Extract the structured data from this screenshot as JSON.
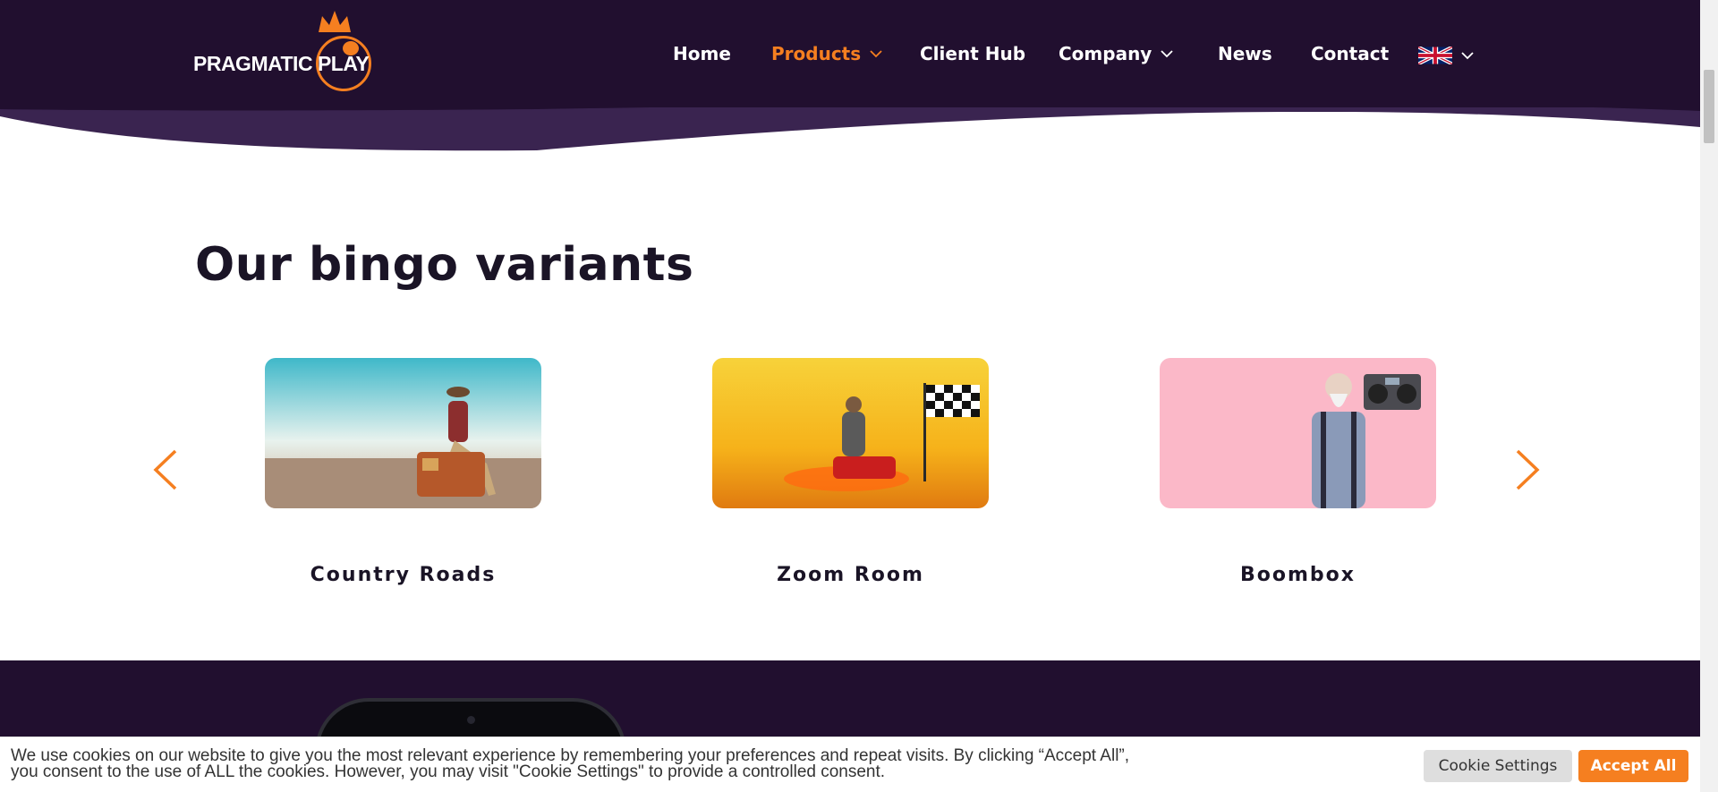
{
  "header": {
    "logo_text_left": "PRAGMATIC",
    "logo_text_right": "PLAY",
    "nav": [
      {
        "label": "Home"
      },
      {
        "label": "Products"
      },
      {
        "label": "Client Hub"
      },
      {
        "label": "Company"
      },
      {
        "label": "News"
      },
      {
        "label": "Contact"
      }
    ],
    "language_icon": "uk-flag-icon",
    "active_nav": "Products",
    "accent_color": "#f57f20",
    "header_color": "#210f2f"
  },
  "section": {
    "title": "Our bingo variants",
    "prev_icon": "chevron-left-icon",
    "next_icon": "chevron-right-icon",
    "cards": [
      {
        "title": "Country Roads"
      },
      {
        "title": "Zoom Room"
      },
      {
        "title": "Boombox"
      }
    ]
  },
  "cookie_bar": {
    "text": "We use cookies on our website to give you the most relevant experience by remembering your preferences and repeat visits. By clicking “Accept All”, you consent to the use of ALL the cookies. However, you may visit \"Cookie Settings\" to provide a controlled consent.",
    "settings_label": "Cookie Settings",
    "accept_label": "Accept All"
  }
}
